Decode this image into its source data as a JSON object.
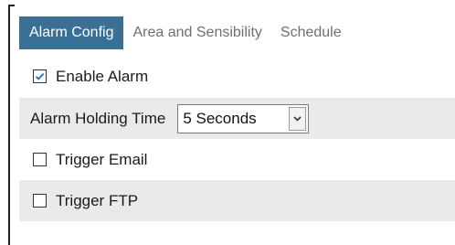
{
  "tabs": {
    "items": [
      {
        "label": "Alarm Config",
        "active": true
      },
      {
        "label": "Area and Sensibility",
        "active": false
      },
      {
        "label": "Schedule",
        "active": false
      }
    ]
  },
  "form": {
    "enable_alarm": {
      "label": "Enable Alarm",
      "checked": true
    },
    "alarm_holding_time": {
      "label": "Alarm Holding Time",
      "value": "5 Seconds"
    },
    "trigger_email": {
      "label": "Trigger Email",
      "checked": false
    },
    "trigger_ftp": {
      "label": "Trigger FTP",
      "checked": false
    }
  },
  "colors": {
    "active_tab": "#3a6f96",
    "shaded_row": "#eaeaea",
    "checkmark": "#1a6fc4"
  }
}
